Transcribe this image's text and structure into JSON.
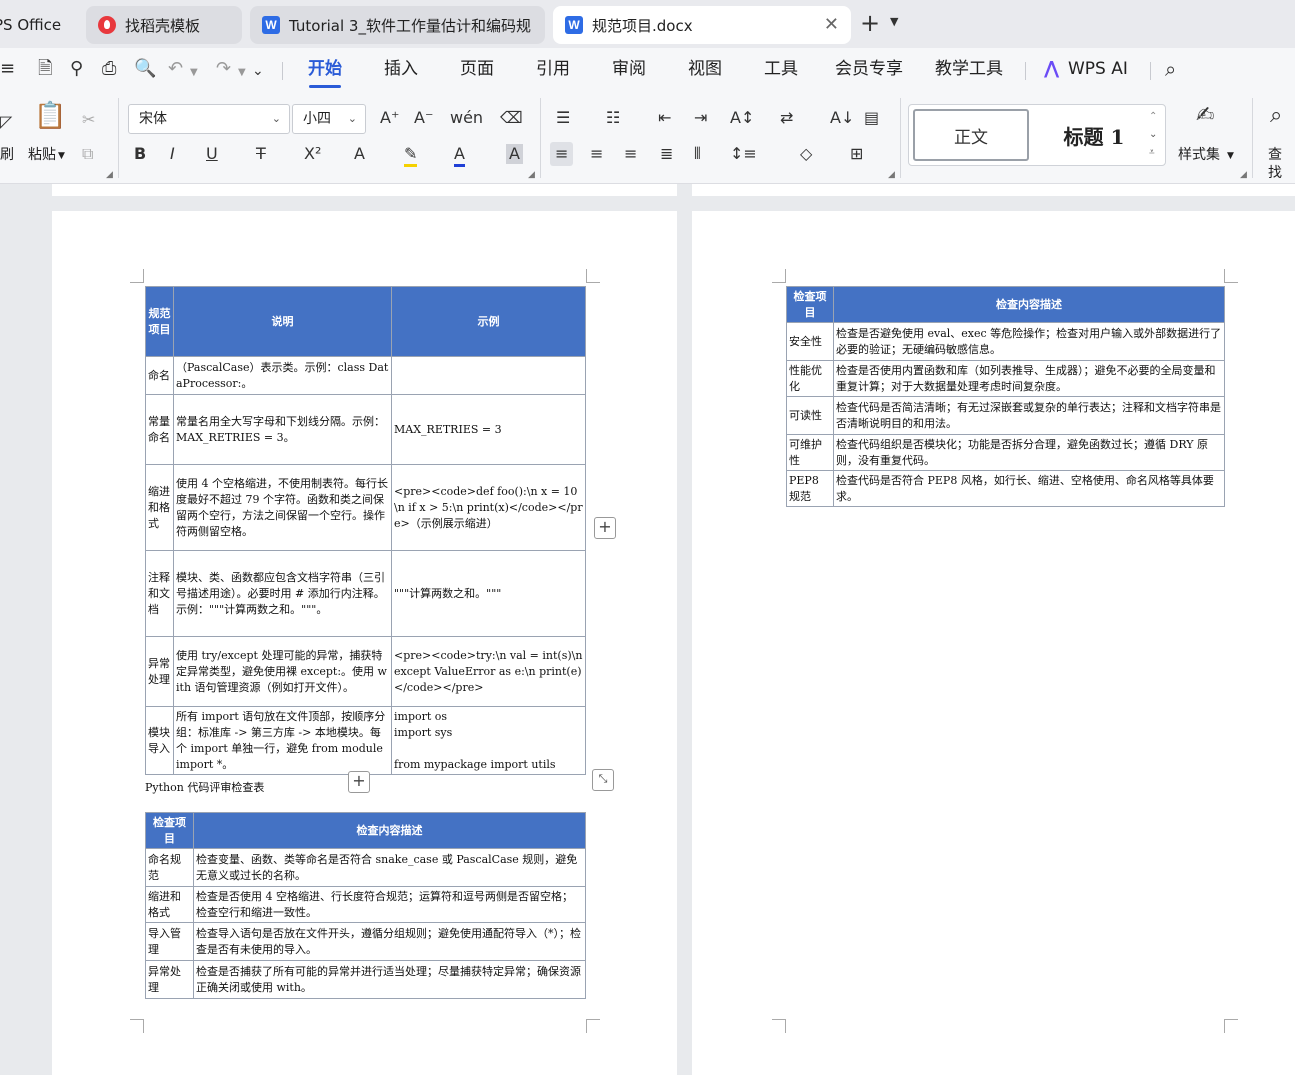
{
  "tabs": [
    {
      "label": "PS Office"
    },
    {
      "label": "找稻壳模板"
    },
    {
      "label": "Tutorial 3_软件工作量估计和编码规"
    },
    {
      "label": "规范项目.docx"
    }
  ],
  "menu": {
    "items": [
      "开始",
      "插入",
      "页面",
      "引用",
      "审阅",
      "视图",
      "工具",
      "会员专享",
      "教学工具",
      "WPS AI"
    ],
    "active": "开始"
  },
  "ribbon": {
    "format_painter": "刷",
    "paste": "粘贴",
    "font_name": "宋体",
    "font_size": "小四",
    "style_normal": "正文",
    "style_heading1": "标题 1",
    "style_set": "样式集",
    "find": "查找"
  },
  "page1": {
    "table1": {
      "headers": [
        "规范项目",
        "说明",
        "示例"
      ],
      "rows": [
        {
          "item": "命名",
          "desc": "（PascalCase）表示类。示例：class DataProcessor:。",
          "example": ""
        },
        {
          "item": "常量命名",
          "desc": "常量名用全大写字母和下划线分隔。示例：MAX_RETRIES = 3。",
          "example": "MAX_RETRIES = 3"
        },
        {
          "item": "缩进和格式",
          "desc": "使用 4 个空格缩进，不使用制表符。每行长度最好不超过 79 个字符。函数和类之间保留两个空行，方法之间保留一个空行。操作符两侧留空格。",
          "example": "<pre><code>def foo():\\n x = 10\\n if x > 5:\\n print(x)</code></pre>（示例展示缩进）"
        },
        {
          "item": "注释和文档",
          "desc": "模块、类、函数都应包含文档字符串（三引号描述用途）。必要时用 # 添加行内注释。示例：\"\"\"计算两数之和。\"\"\"。",
          "example": "\"\"\"计算两数之和。\"\"\""
        },
        {
          "item": "异常处理",
          "desc": "使用 try/except 处理可能的异常，捕获特定异常类型，避免使用裸 except:。使用 with 语句管理资源（例如打开文件）。",
          "example": "<pre><code>try:\\n val = int(s)\\nexcept ValueError as e:\\n print(e)</code></pre>"
        },
        {
          "item": "模块导入",
          "desc": "所有 import 语句放在文件顶部，按顺序分组：标准库 -> 第三方库 -> 本地模块。每个 import 单独一行，避免 from module import *。",
          "example": "import os\nimport sys\n\nfrom mypackage import utils"
        }
      ]
    },
    "caption": "Python 代码评审检查表",
    "table2": {
      "headers": [
        "检查项目",
        "检查内容描述"
      ],
      "rows": [
        {
          "item": "命名规范",
          "desc": "检查变量、函数、类等命名是否符合 snake_case 或 PascalCase 规则，避免无意义或过长的名称。"
        },
        {
          "item": "缩进和格式",
          "desc": "检查是否使用 4 空格缩进、行长度符合规范；运算符和逗号两侧是否留空格；检查空行和缩进一致性。"
        },
        {
          "item": "导入管理",
          "desc": "检查导入语句是否放在文件开头，遵循分组规则；避免使用通配符导入（*）；检查是否有未使用的导入。"
        },
        {
          "item": "异常处理",
          "desc": "检查是否捕获了所有可能的异常并进行适当处理；尽量捕获特定异常；确保资源正确关闭或使用 with。"
        }
      ]
    }
  },
  "page2": {
    "table": {
      "headers": [
        "检查项目",
        "检查内容描述"
      ],
      "rows": [
        {
          "item": "安全性",
          "desc": "检查是否避免使用 eval、exec 等危险操作；检查对用户输入或外部数据进行了必要的验证；无硬编码敏感信息。"
        },
        {
          "item": "性能优化",
          "desc": "检查是否使用内置函数和库（如列表推导、生成器）；避免不必要的全局变量和重复计算；对于大数据量处理考虑时间复杂度。"
        },
        {
          "item": "可读性",
          "desc": "检查代码是否简洁清晰；有无过深嵌套或复杂的单行表达；注释和文档字符串是否清晰说明目的和用法。"
        },
        {
          "item": "可维护性",
          "desc": "检查代码组织是否模块化；功能是否拆分合理，避免函数过长；遵循 DRY 原则，没有重复代码。"
        },
        {
          "item": "PEP8 规范",
          "desc": "检查代码是否符合 PEP8 风格，如行长、缩进、空格使用、命名风格等具体要求。"
        }
      ]
    }
  },
  "colors": {
    "header_blue": "#4472c4",
    "accent": "#2a5bd7"
  }
}
